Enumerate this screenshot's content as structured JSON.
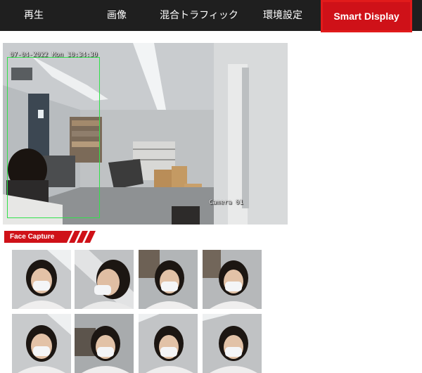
{
  "nav": {
    "items": [
      {
        "label": "再生"
      },
      {
        "label": "画像"
      },
      {
        "label": "混合トラフィック"
      },
      {
        "label": "環境設定"
      }
    ],
    "active_label": "Smart Display",
    "accent": "#cf1118"
  },
  "live_view": {
    "timestamp": "07-04-2022 Mon 10:34:30",
    "camera_name": "Camera 01",
    "detection_box_color": "#32e14b"
  },
  "face_capture": {
    "title": "Face Capture",
    "thumbnail_count": 8
  }
}
